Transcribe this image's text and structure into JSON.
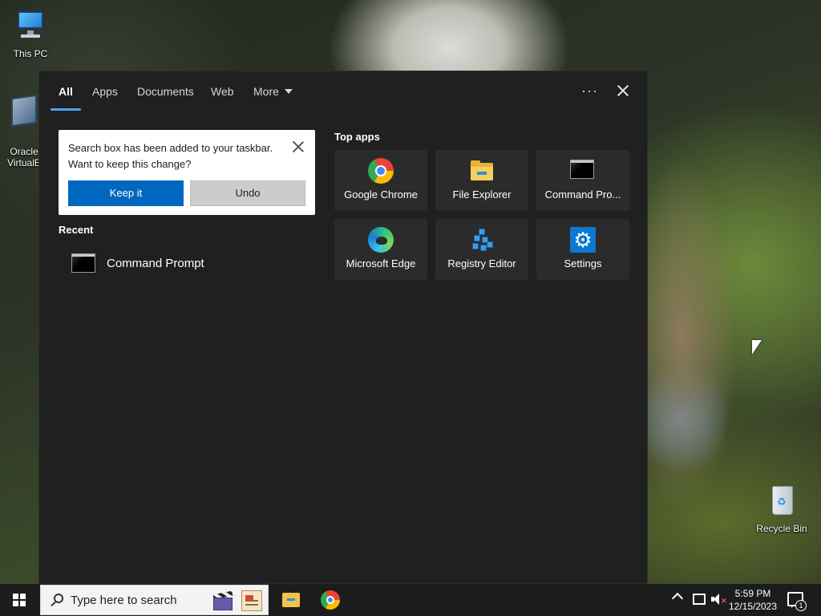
{
  "desktop": {
    "icons": [
      {
        "label": "This PC",
        "icon": "computer-icon"
      },
      {
        "label": "Oracle\nVirtualB",
        "icon": "virtualbox-icon"
      },
      {
        "label": "Recycle Bin",
        "icon": "recycle-bin-icon"
      }
    ]
  },
  "search_panel": {
    "tabs": [
      {
        "label": "All",
        "active": true
      },
      {
        "label": "Apps"
      },
      {
        "label": "Documents"
      },
      {
        "label": "Web"
      },
      {
        "label": "More"
      }
    ],
    "more_options_label": "···",
    "notification": {
      "message": "Search box has been added to your taskbar. Want to keep this change?",
      "keep_label": "Keep it",
      "undo_label": "Undo"
    },
    "recent": {
      "title": "Recent",
      "items": [
        {
          "label": "Command Prompt",
          "icon": "command-prompt-icon"
        }
      ]
    },
    "top_apps": {
      "title": "Top apps",
      "items": [
        {
          "label": "Google Chrome",
          "icon": "chrome-icon"
        },
        {
          "label": "File Explorer",
          "icon": "file-explorer-icon"
        },
        {
          "label": "Command Pro...",
          "icon": "command-prompt-icon"
        },
        {
          "label": "Microsoft Edge",
          "icon": "edge-icon"
        },
        {
          "label": "Registry Editor",
          "icon": "registry-editor-icon"
        },
        {
          "label": "Settings",
          "icon": "settings-icon"
        }
      ]
    }
  },
  "taskbar": {
    "search_placeholder": "Type here to search",
    "pinned": [
      {
        "name": "File Explorer",
        "icon": "file-explorer-icon"
      },
      {
        "name": "Google Chrome",
        "icon": "chrome-icon"
      }
    ],
    "clock": {
      "time": "5:59 PM",
      "date": "12/15/2023"
    },
    "notification_count": "1"
  },
  "colors": {
    "panel_bg": "#202020",
    "tile_bg": "#2b2b2b",
    "accent": "#0067c0",
    "tab_underline": "#4aa3f0",
    "taskbar_bg": "#1c1c1c"
  }
}
